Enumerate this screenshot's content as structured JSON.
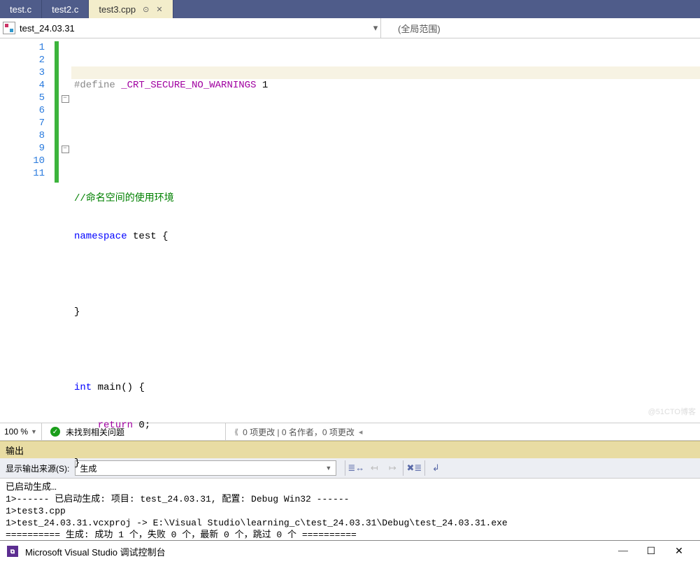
{
  "tabs": [
    {
      "label": "test.c",
      "active": false
    },
    {
      "label": "test2.c",
      "active": false
    },
    {
      "label": "test3.cpp",
      "active": true
    }
  ],
  "nav": {
    "left": "test_24.03.31",
    "right": "(全局范围)"
  },
  "code": {
    "lines": [
      "1",
      "2",
      "3",
      "4",
      "5",
      "6",
      "7",
      "8",
      "9",
      "10",
      "11"
    ],
    "l1_define": "#define ",
    "l1_macro": "_CRT_SECURE_NO_WARNINGS",
    "l1_val": " 1",
    "l4": "//命名空间的使用环境",
    "l5_kw": "namespace",
    "l5_name": " test ",
    "l5_brace": "{",
    "l7": "}",
    "l9_kw": "int",
    "l9_name": " main() ",
    "l9_brace": "{",
    "l10_indent": "    ",
    "l10_kw": "return",
    "l10_val": " 0",
    "l10_semi": ";",
    "l11": "}"
  },
  "status": {
    "zoom": "100 %",
    "ok": "未找到相关问题",
    "changes": "0 项更改 | 0 名作者，0 项更改"
  },
  "output": {
    "title": "输出",
    "source_label": "显示输出来源(S):",
    "source_value": "生成",
    "body": "已启动生成…\n1>------ 已启动生成: 项目: test_24.03.31, 配置: Debug Win32 ------\n1>test3.cpp\n1>test_24.03.31.vcxproj -> E:\\Visual Studio\\learning_c\\test_24.03.31\\Debug\\test_24.03.31.exe\n========== 生成: 成功 1 个，失败 0 个，最新 0 个，跳过 0 个 =========="
  },
  "console": {
    "title": "Microsoft Visual Studio 调试控制台"
  },
  "watermark": "@51CTO博客"
}
